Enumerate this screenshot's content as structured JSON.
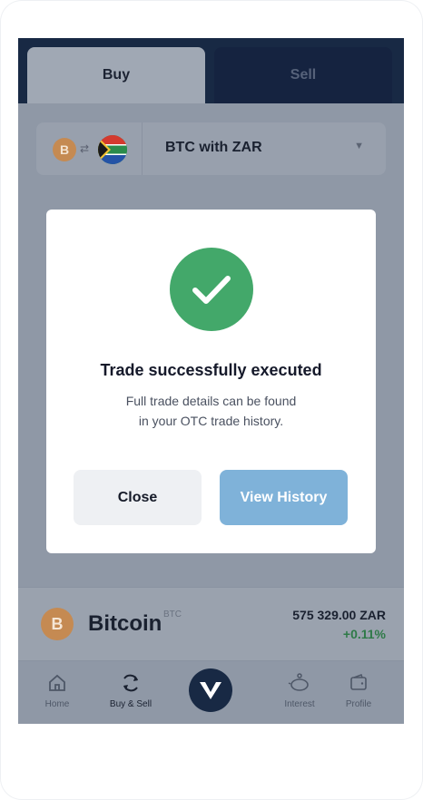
{
  "tabs": {
    "buy": "Buy",
    "sell": "Sell"
  },
  "pair_selector": {
    "label": "BTC with ZAR",
    "from_icon": "bitcoin-icon",
    "to_icon": "south-africa-flag-icon",
    "coin_symbol": "B"
  },
  "asset": {
    "name": "Bitcoin",
    "ticker": "BTC",
    "price": "575 329.00 ZAR",
    "change": "+0.11%",
    "change_color": "#2f7a48",
    "coin_symbol": "B"
  },
  "nav": [
    {
      "label": "Home",
      "icon": "home-icon"
    },
    {
      "label": "Buy & Sell",
      "icon": "refresh-icon"
    },
    {
      "label": "",
      "icon": "brand-logo-icon"
    },
    {
      "label": "Interest",
      "icon": "piggy-bank-icon"
    },
    {
      "label": "Profile",
      "icon": "wallet-icon"
    }
  ],
  "modal": {
    "title": "Trade successfully executed",
    "message_line1": "Full trade details can be found",
    "message_line2": "in your OTC trade history.",
    "close_label": "Close",
    "history_label": "View History",
    "success_color": "#43a86a",
    "accent_color": "#7fb2d9"
  }
}
